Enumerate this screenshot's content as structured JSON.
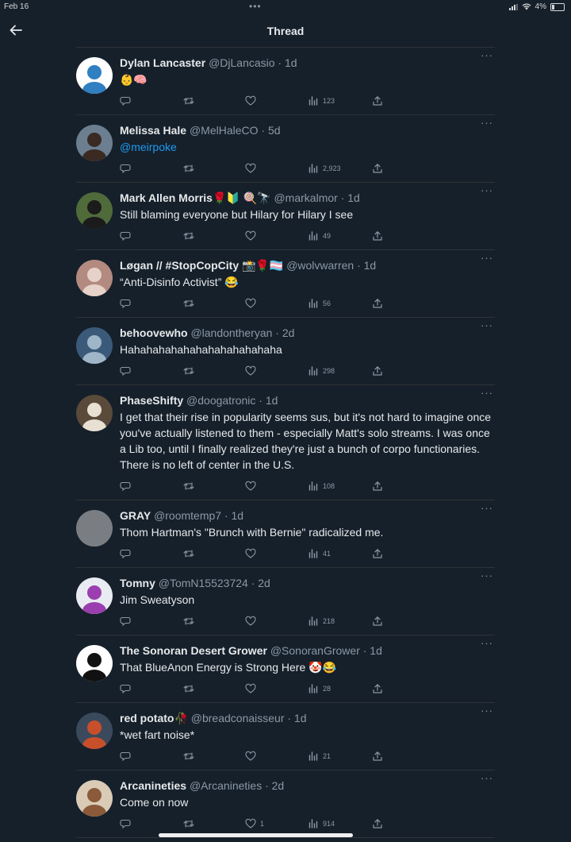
{
  "status": {
    "time": "Feb 16",
    "battery": "4%"
  },
  "header": {
    "title": "Thread"
  },
  "tweets": [
    {
      "name": "Dylan Lancaster",
      "handle": "@DjLancasio · 1d",
      "text": "👶🧠",
      "likes": "",
      "views": "123",
      "avatar_bg": "#ffffff",
      "avatar_fg": "#2f7fc1"
    },
    {
      "name": "Melissa Hale",
      "handle": "@MelHaleCO · 5d",
      "text": "@meirpoke",
      "likes": "",
      "views": "2,923",
      "avatar_bg": "#6b7f91",
      "avatar_fg": "#3a2a22"
    },
    {
      "name": "Mark Allen Morris🌹🔰 🍭🔭",
      "handle": "@markalmor · 1d",
      "text": "Still blaming everyone but Hilary for Hilary I see",
      "likes": "",
      "views": "49",
      "avatar_bg": "#4f6b3a",
      "avatar_fg": "#1b1b1b"
    },
    {
      "name": "Løgan // #StopCopCity 📸🌹🏳️‍⚧️",
      "handle": "@wolvwarren · 1d",
      "text": "“Anti-Disinfo Activist” 😂",
      "likes": "",
      "views": "56",
      "avatar_bg": "#b38a80",
      "avatar_fg": "#e6d2c8"
    },
    {
      "name": "behoovewho",
      "handle": "@landontheryan · 2d",
      "text": "Hahahahahahahahahahahahaha",
      "likes": "",
      "views": "298",
      "avatar_bg": "#3b5a7a",
      "avatar_fg": "#9fb6c9"
    },
    {
      "name": "PhaseShifty",
      "handle": "@doogatronic · 1d",
      "text": "I get that their rise in popularity seems sus, but it's not hard to imagine once you've actually listened to them - especially Matt's solo streams. I was once a Lib too, until I finally realized they're just a bunch of corpo functionaries. There is no left of center in the U.S.",
      "likes": "",
      "views": "108",
      "avatar_bg": "#5a4a3a",
      "avatar_fg": "#e8e0d2"
    },
    {
      "name": "GRAY",
      "handle": "@roomtemp7 · 1d",
      "text": "Thom Hartman's \"Brunch with Bernie\" radicalized me.",
      "likes": "",
      "views": "41",
      "avatar_bg": "#7a7e82",
      "avatar_fg": "#7a7e82"
    },
    {
      "name": "Tomny",
      "handle": "@TomN15523724 · 2d",
      "text": "Jim Sweatyson",
      "likes": "",
      "views": "218",
      "avatar_bg": "#e8ecf2",
      "avatar_fg": "#9b3fb0"
    },
    {
      "name": "The Sonoran Desert Grower",
      "handle": "@SonoranGrower · 1d",
      "text": "That BlueAnon Energy is Strong Here 🤡😂",
      "likes": "",
      "views": "28",
      "avatar_bg": "#ffffff",
      "avatar_fg": "#111111"
    },
    {
      "name": "red potato🥀",
      "handle": "@breadconaisseur · 1d",
      "text": "*wet fart noise*",
      "likes": "",
      "views": "21",
      "avatar_bg": "#3a4a5c",
      "avatar_fg": "#c7502a"
    },
    {
      "name": "Arcanineties",
      "handle": "@Arcanineties · 2d",
      "text": "Come on now",
      "likes": "1",
      "views": "914",
      "avatar_bg": "#d9cbb6",
      "avatar_fg": "#8a5a3a"
    }
  ]
}
